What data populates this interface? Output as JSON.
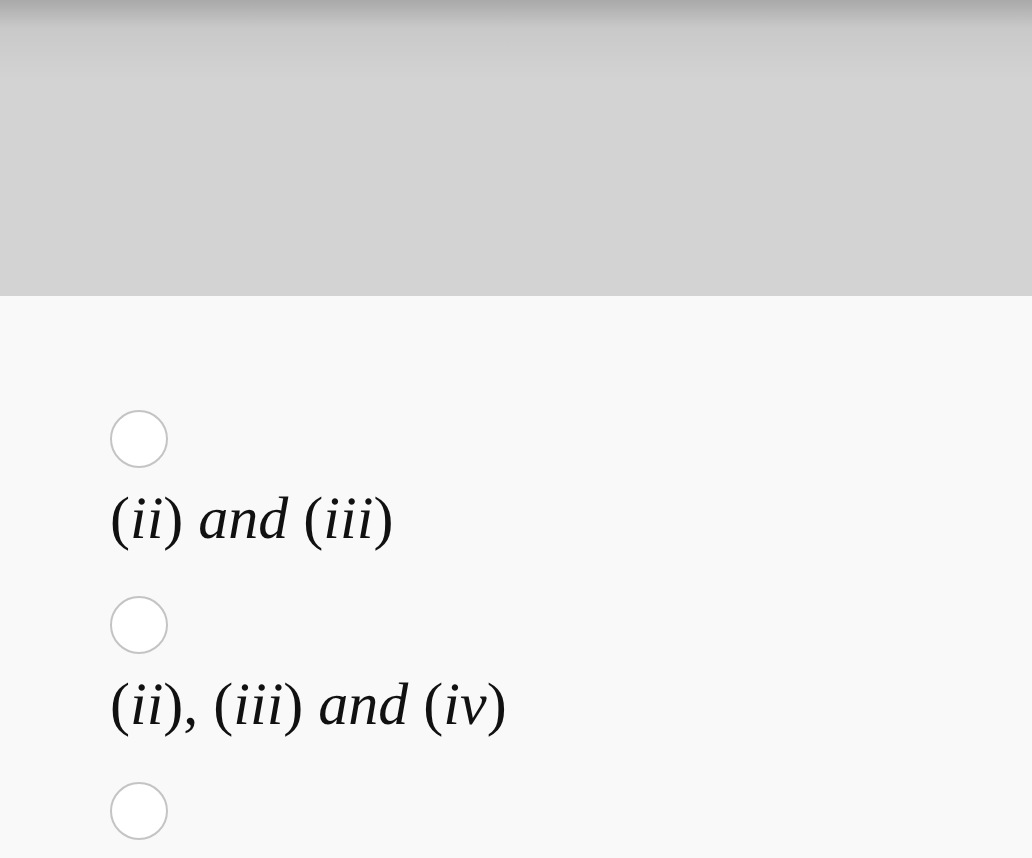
{
  "options": [
    {
      "label": "(*ii*) *and* (*iii*)",
      "selected": false
    },
    {
      "label": "(*ii*), (*iii*) *and* (*iv*)",
      "selected": false
    },
    {
      "selected": false
    }
  ]
}
